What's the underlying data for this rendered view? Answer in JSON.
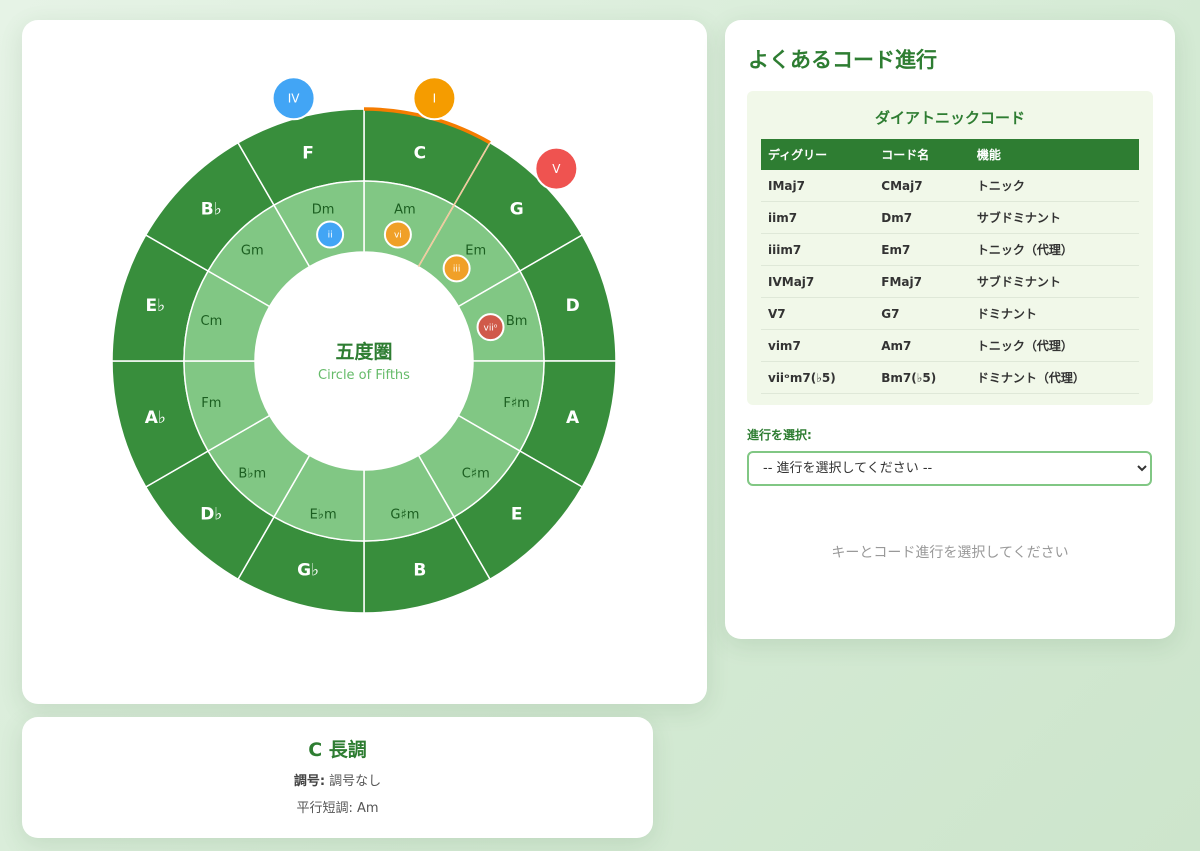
{
  "circle": {
    "major_keys": [
      "C",
      "G",
      "D",
      "A",
      "E",
      "B",
      "G♭",
      "D♭",
      "A♭",
      "E♭",
      "B♭",
      "F"
    ],
    "minor_keys": [
      "Am",
      "Em",
      "Bm",
      "F♯m",
      "C♯m",
      "G♯m",
      "E♭m",
      "B♭m",
      "Fm",
      "Cm",
      "Gm",
      "Dm"
    ],
    "center_title": "五度圏",
    "center_subtitle": "Circle of Fifths",
    "selected_key": "C",
    "degree_markers": [
      {
        "label": "IV",
        "color": "#42a5f5",
        "ring": "outer",
        "key": "F"
      },
      {
        "label": "I",
        "color": "#f59c00",
        "ring": "outer",
        "key": "C"
      },
      {
        "label": "V",
        "color": "#ef5350",
        "ring": "outer",
        "key": "G"
      },
      {
        "label": "ii",
        "color": "#42a5f5",
        "ring": "inner",
        "key": "Dm"
      },
      {
        "label": "vi",
        "color": "#f0a028",
        "ring": "inner",
        "key": "Am"
      },
      {
        "label": "iii",
        "color": "#f0a028",
        "ring": "inner",
        "key": "Em"
      },
      {
        "label": "viiᵒ",
        "color": "#d05a4a",
        "ring": "inner",
        "key": "Bm"
      }
    ],
    "colors": {
      "outer": "#388e3c",
      "inner": "#81c784",
      "selected": "#f57c00"
    }
  },
  "key_info": {
    "title": "C 長調",
    "signature_label": "調号:",
    "signature_value": "調号なし",
    "relative_label": "平行短調:",
    "relative_value": "Am"
  },
  "progressions": {
    "title": "よくあるコード進行",
    "diatonic_title": "ダイアトニックコード",
    "headers": [
      "ディグリー",
      "コード名",
      "機能"
    ],
    "rows": [
      [
        "IMaj7",
        "CMaj7",
        "トニック"
      ],
      [
        "iim7",
        "Dm7",
        "サブドミナント"
      ],
      [
        "iiim7",
        "Em7",
        "トニック（代理）"
      ],
      [
        "IVMaj7",
        "FMaj7",
        "サブドミナント"
      ],
      [
        "V7",
        "G7",
        "ドミナント"
      ],
      [
        "vim7",
        "Am7",
        "トニック（代理）"
      ],
      [
        "viiᵒm7(♭5)",
        "Bm7(♭5)",
        "ドミナント（代理）"
      ]
    ],
    "select_label": "進行を選択:",
    "select_placeholder": "-- 進行を選択してください --",
    "empty_message": "キーとコード進行を選択してください"
  }
}
